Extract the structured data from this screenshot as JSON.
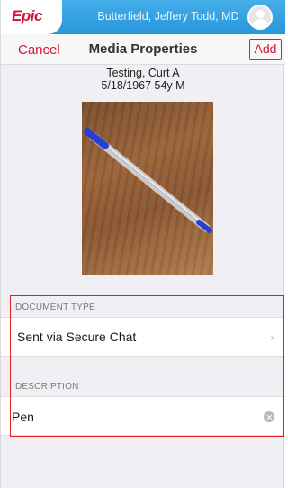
{
  "topbar": {
    "logo": "Epic",
    "user_name": "Butterfield, Jeffery Todd, MD",
    "avatar_icon": "user-avatar-icon",
    "color": "#2f9fe0"
  },
  "navbar": {
    "cancel_label": "Cancel",
    "title": "Media Properties",
    "add_label": "Add",
    "accent_color": "#d3163d"
  },
  "patient": {
    "name": "Testing, Curt A",
    "dob_age_sex": "5/18/1967 54y M"
  },
  "media": {
    "subject": "photo-of-blue-pen-on-wood"
  },
  "document_type": {
    "header": "DOCUMENT TYPE",
    "value": "Sent via Secure Chat",
    "chevron": "›"
  },
  "description": {
    "header": "DESCRIPTION",
    "value": "Pen"
  }
}
